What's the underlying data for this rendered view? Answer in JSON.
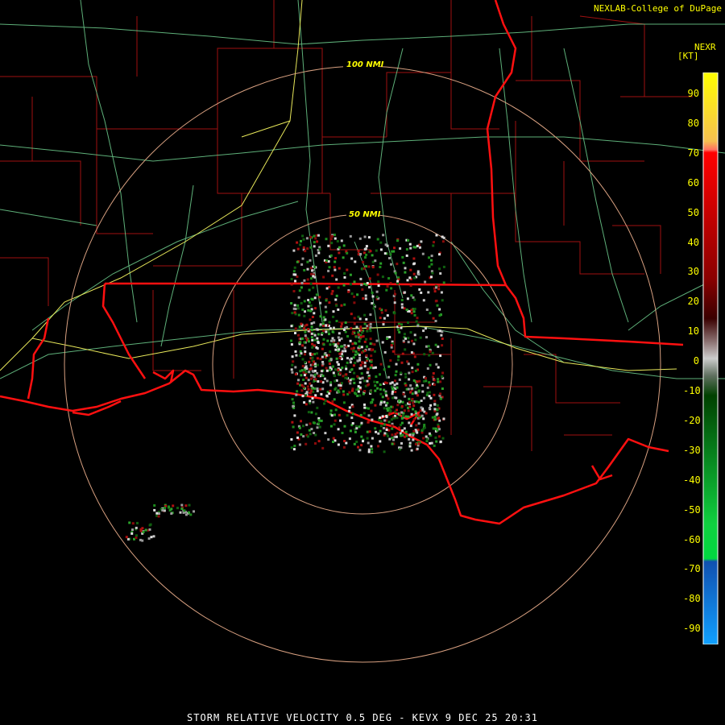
{
  "credit": "NEXLAB-College of DuPage",
  "product_code": "NEXR",
  "legend_unit": "[KT]",
  "legend_ticks": [
    "90",
    "80",
    "70",
    "60",
    "50",
    "40",
    "30",
    "20",
    "10",
    "0",
    "-10",
    "-20",
    "-30",
    "-40",
    "-50",
    "-60",
    "-70",
    "-80",
    "-90"
  ],
  "range_rings": [
    {
      "label": "100 NMI"
    },
    {
      "label": "50 NMI"
    }
  ],
  "footer": "STORM RELATIVE VELOCITY 0.5 DEG - KEVX 9 DEC 25 20:31",
  "colors": {
    "state_border": "#ff1010",
    "county_border": "#b01515",
    "roads_minor": "#6fcf8f",
    "interstate": "#e8e85a",
    "range_ring": "#d8a080",
    "label": "#ffff00"
  }
}
